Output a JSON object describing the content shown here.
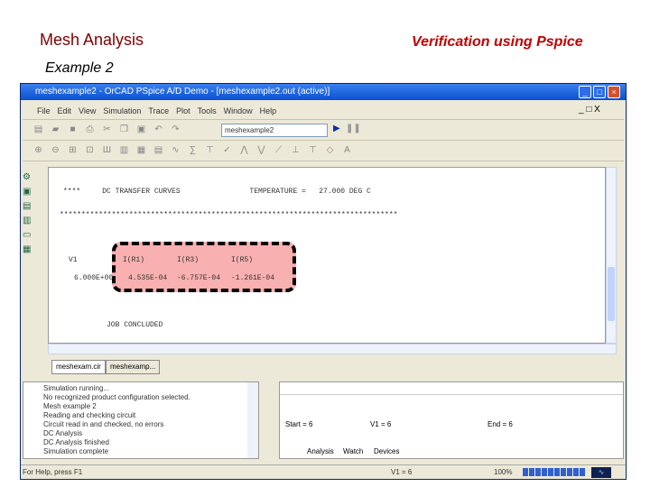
{
  "slide": {
    "title": "Mesh Analysis",
    "subtitle": "Example 2",
    "right_title": "Verification using Pspice"
  },
  "window": {
    "title": "meshexample2 - OrCAD PSpice A/D Demo - [meshexample2.out (active)]"
  },
  "menu": [
    "File",
    "Edit",
    "View",
    "Simulation",
    "Trace",
    "Plot",
    "Tools",
    "Window",
    "Help"
  ],
  "toolbar": {
    "profile": "meshexample2"
  },
  "output": {
    "header": "****     DC TRANSFER CURVES                TEMPERATURE =   27.000 DEG C",
    "stars": "******************************************************************************",
    "columns": [
      "V1",
      "I(R1)",
      "I(R3)",
      "I(R5)"
    ],
    "values": [
      "6.000E+00",
      "4.535E-04",
      "-6.757E-04",
      "-1.261E-04"
    ],
    "footer": "JOB CONCLUDED"
  },
  "tabs": [
    "meshexam.cir",
    "meshexamp..."
  ],
  "log": [
    "Simulation running...",
    "No recognized product configuration selected.",
    "Mesh example 2",
    "Reading and checking circuit",
    "Circuit read in and checked, no errors",
    "DC Analysis",
    "DC Analysis finished",
    "Simulation complete"
  ],
  "analysis": {
    "start": "Start = 6",
    "v1": "V1 = 6",
    "end": "End = 6",
    "tabs": [
      "Analysis",
      "Watch",
      "Devices"
    ]
  },
  "status": {
    "help": "For Help, press F1",
    "v1": "V1 = 6",
    "percent": "100%",
    "progress": 1.0
  }
}
